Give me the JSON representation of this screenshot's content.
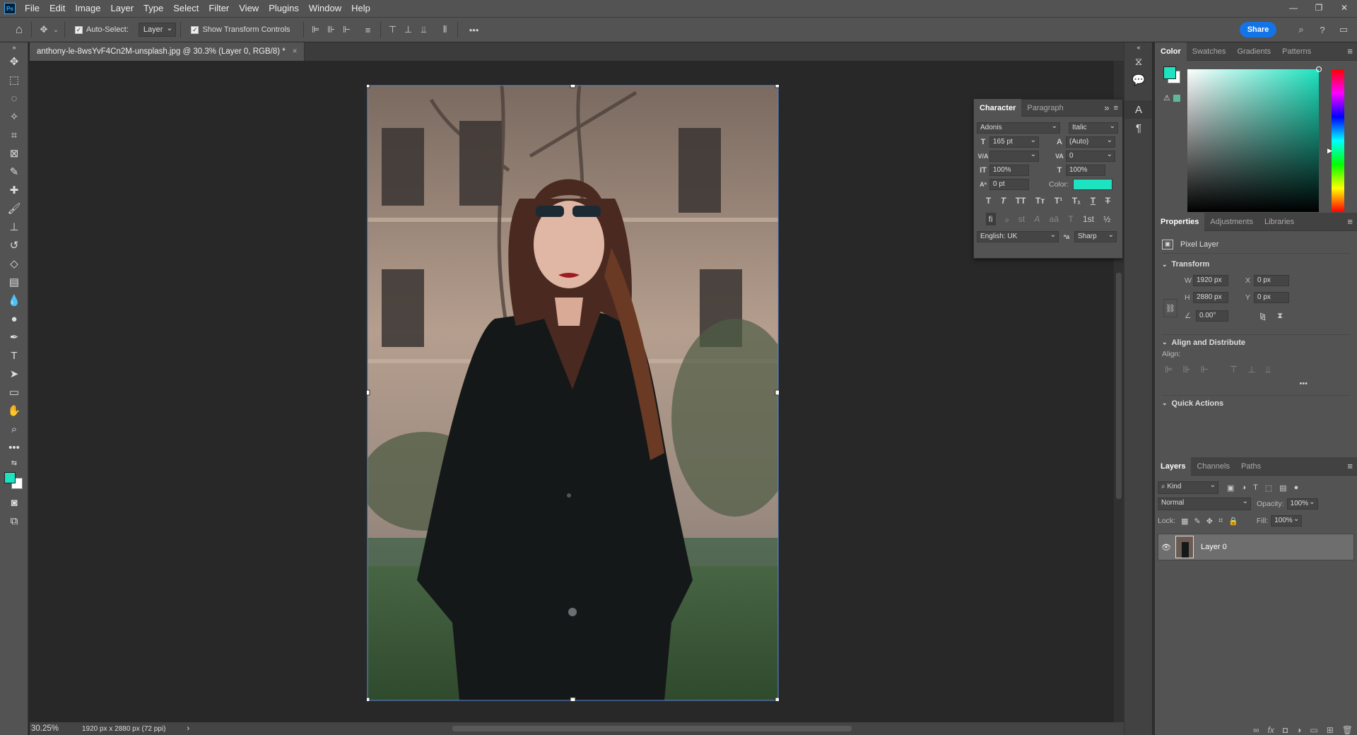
{
  "app": {
    "logo": "Ps"
  },
  "menu": [
    "File",
    "Edit",
    "Image",
    "Layer",
    "Type",
    "Select",
    "Filter",
    "View",
    "Plugins",
    "Window",
    "Help"
  ],
  "window_controls": {
    "minimize": "—",
    "restore": "❐",
    "close": "✕"
  },
  "options": {
    "auto_select_label": "Auto-Select:",
    "auto_select_value": "Layer",
    "show_transform_label": "Show Transform Controls",
    "more": "•••",
    "share_label": "Share"
  },
  "document": {
    "tab_title": "anthony-le-8wsYvF4Cn2M-unsplash.jpg @ 30.3% (Layer 0, RGB/8) *",
    "close": "×"
  },
  "status": {
    "zoom": "30.25%",
    "dimensions": "1920 px x 2880 px (72 ppi)",
    "arrow": "›"
  },
  "character": {
    "tabs": [
      "Character",
      "Paragraph"
    ],
    "font_family": "Adonis",
    "font_style": "Italic",
    "size": "165 pt",
    "leading": "(Auto)",
    "kerning": "",
    "tracking": "0",
    "vscale": "100%",
    "hscale": "100%",
    "baseline": "0 pt",
    "color_label": "Color:",
    "color": "#1de3c0",
    "glyphs1": [
      "T",
      "T",
      "TT",
      "Tт",
      "T¹",
      "T₁",
      "T",
      "T"
    ],
    "glyphs2": [
      "fi",
      "ℴ",
      "st",
      "A",
      "aā",
      "T",
      "1st",
      "½"
    ],
    "language": "English: UK",
    "aa_icon": "ªa",
    "antialias": "Sharp"
  },
  "color_panel": {
    "tabs": [
      "Color",
      "Swatches",
      "Gradients",
      "Patterns"
    ],
    "fg": "#1de3c0",
    "bg": "#ffffff"
  },
  "properties": {
    "tabs": [
      "Properties",
      "Adjustments",
      "Libraries"
    ],
    "layer_type": "Pixel Layer",
    "transform_title": "Transform",
    "w_label": "W",
    "w": "1920 px",
    "h_label": "H",
    "h": "2880 px",
    "x_label": "X",
    "x": "0 px",
    "y_label": "Y",
    "y": "0 px",
    "angle": "0.00°",
    "align_title": "Align and Distribute",
    "align_label": "Align:",
    "more": "•••",
    "quick_title": "Quick Actions"
  },
  "layers": {
    "tabs": [
      "Layers",
      "Channels",
      "Paths"
    ],
    "filter_label": "Kind",
    "blend_mode": "Normal",
    "opacity_label": "Opacity:",
    "opacity": "100%",
    "lock_label": "Lock:",
    "fill_label": "Fill:",
    "fill": "100%",
    "items": [
      {
        "name": "Layer 0",
        "visible": true
      }
    ],
    "footer_icons": [
      "∞",
      "fx",
      "◘",
      "◑",
      "▭",
      "⊞",
      "🗑"
    ]
  }
}
